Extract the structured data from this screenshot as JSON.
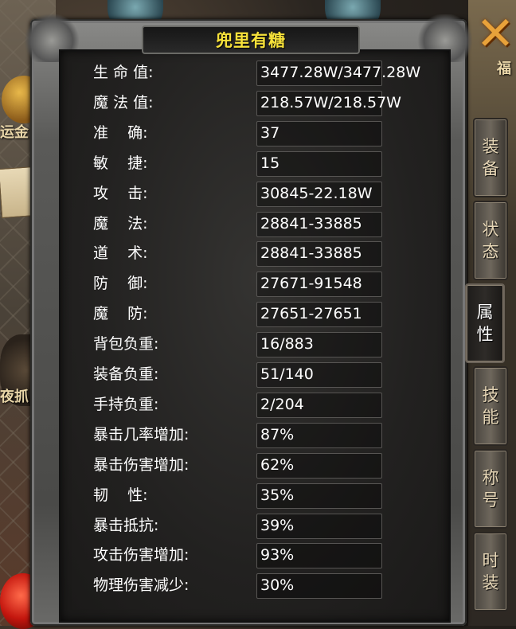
{
  "window": {
    "title": "兜里有糖"
  },
  "side_labels": {
    "left_top": "运金",
    "left_mid": "夜抓",
    "right_top": "福"
  },
  "stats": [
    {
      "label": "生 命 值:",
      "value": "3477.28W/3477.28W"
    },
    {
      "label": "魔 法 值:",
      "value": "218.57W/218.57W"
    },
    {
      "label": "准    确:",
      "value": "37"
    },
    {
      "label": "敏    捷:",
      "value": "15"
    },
    {
      "label": "攻    击:",
      "value": "30845-22.18W"
    },
    {
      "label": "魔    法:",
      "value": "28841-33885"
    },
    {
      "label": "道    术:",
      "value": "28841-33885"
    },
    {
      "label": "防    御:",
      "value": "27671-91548"
    },
    {
      "label": "魔    防:",
      "value": "27651-27651"
    },
    {
      "label": "背包负重:",
      "value": "16/883"
    },
    {
      "label": "装备负重:",
      "value": "51/140"
    },
    {
      "label": "手持负重:",
      "value": "2/204"
    },
    {
      "label": "暴击几率增加:",
      "value": "87%"
    },
    {
      "label": "暴击伤害增加:",
      "value": "62%"
    },
    {
      "label": "韧    性:",
      "value": "35%"
    },
    {
      "label": "暴击抵抗:",
      "value": "39%"
    },
    {
      "label": "攻击伤害增加:",
      "value": "93%"
    },
    {
      "label": "物理伤害减少:",
      "value": "30%"
    }
  ],
  "tabs": [
    {
      "id": "equipment",
      "chars": [
        "装",
        "备"
      ],
      "active": false
    },
    {
      "id": "status",
      "chars": [
        "状",
        "态"
      ],
      "active": false
    },
    {
      "id": "attributes",
      "chars": [
        "属",
        "性"
      ],
      "active": true
    },
    {
      "id": "skills",
      "chars": [
        "技",
        "能"
      ],
      "active": false
    },
    {
      "id": "titles",
      "chars": [
        "称",
        "号"
      ],
      "active": false
    },
    {
      "id": "fashion",
      "chars": [
        "时",
        "装"
      ],
      "active": false
    }
  ],
  "colors": {
    "title": "#f6e13a",
    "text": "#ffffff",
    "tab_text": "#e6d6b6"
  },
  "icons": {
    "close": "cross-close-icon"
  }
}
